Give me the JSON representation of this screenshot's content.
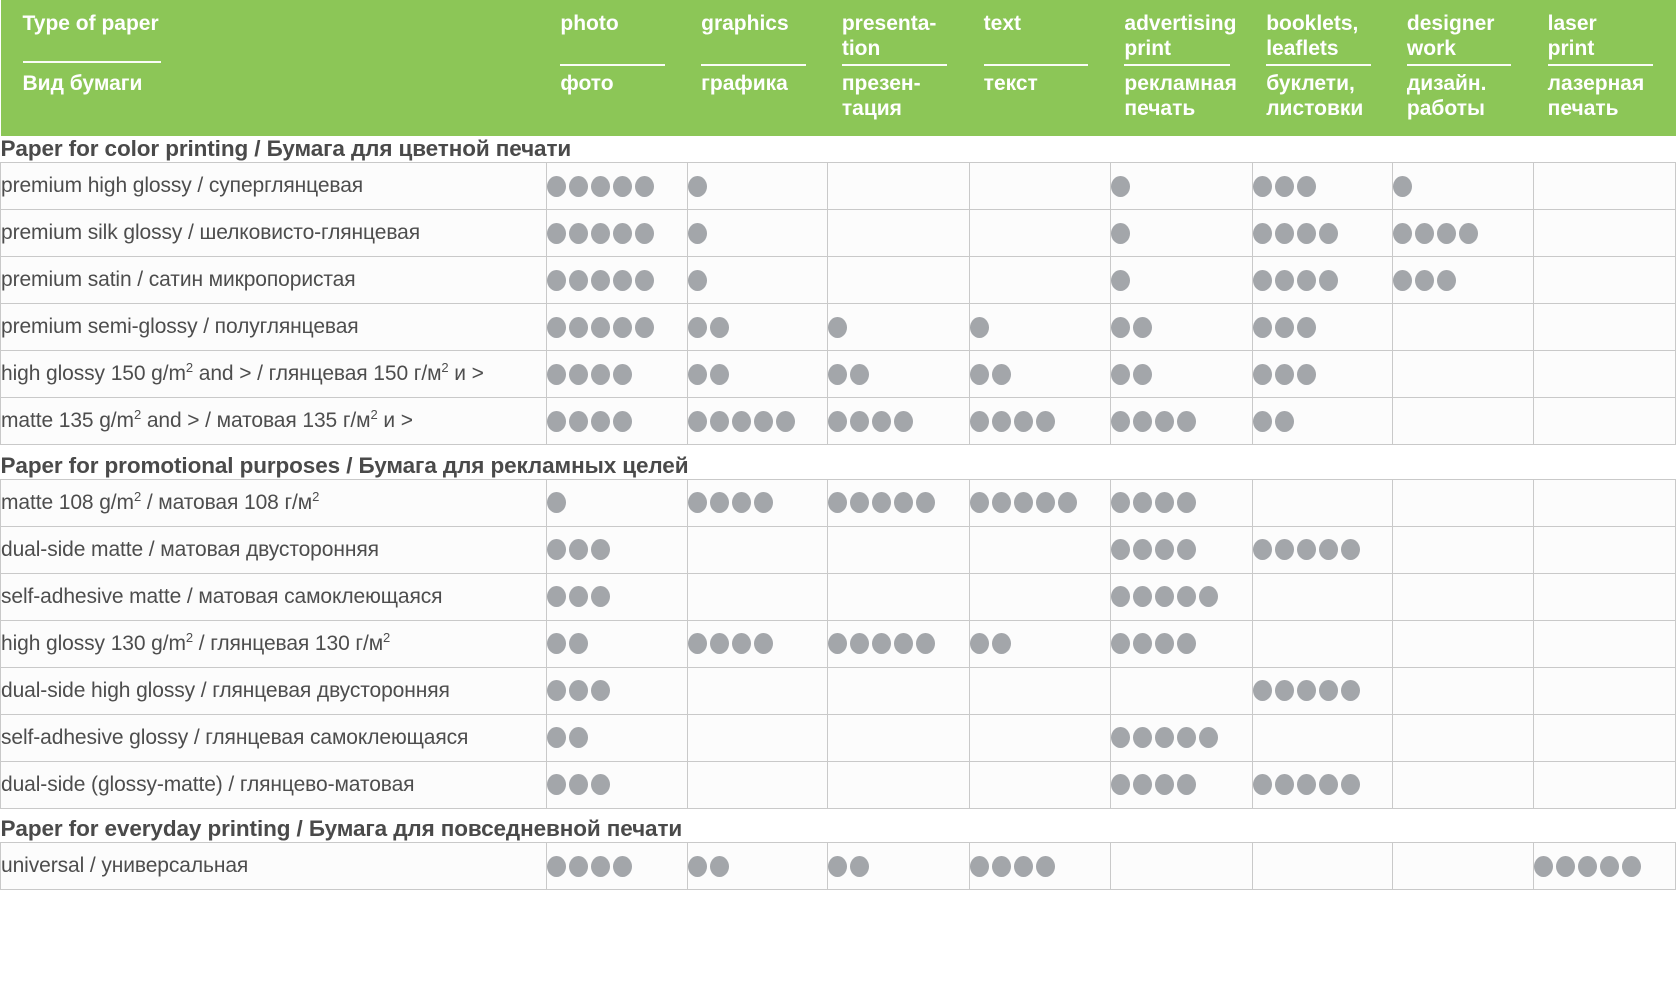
{
  "header": {
    "row_label_col": {
      "en": "Type of paper",
      "ru": "Вид бумаги"
    },
    "columns": [
      {
        "en": "photo",
        "ru": "фото"
      },
      {
        "en": "graphics",
        "ru": "графика"
      },
      {
        "en": "presenta-\ntion",
        "ru": "презен-\nтация"
      },
      {
        "en": "text",
        "ru": "текст"
      },
      {
        "en": "advertising\nprint",
        "ru": "рекламная\nпечать"
      },
      {
        "en": "booklets,\nleaflets",
        "ru": "буклети,\nлистовки"
      },
      {
        "en": "designer\nwork",
        "ru": "дизайн.\nработы"
      },
      {
        "en": "laser\nprint",
        "ru": "лазерная\nпечать"
      }
    ]
  },
  "colors": {
    "header_green": "#8cc657",
    "dot_gray": "#a3a6aa",
    "grid_line": "#c9c9c9",
    "text_dark": "#4d4d4d"
  },
  "sections": [
    {
      "title": "Paper for color printing / Бумага для цветной печати",
      "rows": [
        {
          "label": "premium high glossy / суперглянцевая",
          "dots": [
            5,
            1,
            0,
            0,
            1,
            3,
            1,
            0
          ]
        },
        {
          "label": "premium silk glossy / шелковисто-глянцевая",
          "dots": [
            5,
            1,
            0,
            0,
            1,
            4,
            4,
            0
          ]
        },
        {
          "label": "premium satin / сатин микропористая",
          "dots": [
            5,
            1,
            0,
            0,
            1,
            4,
            3,
            0
          ]
        },
        {
          "label": "premium semi-glossy / полуглянцевая",
          "dots": [
            5,
            2,
            1,
            1,
            2,
            3,
            0,
            0
          ]
        },
        {
          "label": "high glossy 150 g/m² and > / глянцевая 150 г/м² и >",
          "dots": [
            4,
            2,
            2,
            2,
            2,
            3,
            0,
            0
          ]
        },
        {
          "label": "matte 135 g/m² and > / матовая 135 г/м² и >",
          "dots": [
            4,
            5,
            4,
            4,
            4,
            2,
            0,
            0
          ]
        }
      ]
    },
    {
      "title": "Paper for promotional purposes / Бумага для рекламных целей",
      "rows": [
        {
          "label": "matte 108 g/m² / матовая 108 г/м²",
          "dots": [
            1,
            4,
            5,
            5,
            4,
            0,
            0,
            0
          ]
        },
        {
          "label": "dual-side matte / матовая двусторонняя",
          "dots": [
            3,
            0,
            0,
            0,
            4,
            5,
            0,
            0
          ]
        },
        {
          "label": "self-adhesive matte / матовая самоклеющаяся",
          "dots": [
            3,
            0,
            0,
            0,
            5,
            0,
            0,
            0
          ]
        },
        {
          "label": "high glossy 130 g/m² / глянцевая 130 г/м²",
          "dots": [
            2,
            4,
            5,
            2,
            4,
            0,
            0,
            0
          ]
        },
        {
          "label": "dual-side high glossy / глянцевая двусторонняя",
          "dots": [
            3,
            0,
            0,
            0,
            0,
            5,
            0,
            0
          ]
        },
        {
          "label": "self-adhesive glossy / глянцевая самоклеющаяся",
          "dots": [
            2,
            0,
            0,
            0,
            5,
            0,
            0,
            0
          ]
        },
        {
          "label": "dual-side (glossy-matte) / глянцево-матовая",
          "dots": [
            3,
            0,
            0,
            0,
            4,
            5,
            0,
            0
          ]
        }
      ]
    },
    {
      "title": "Paper for everyday printing / Бумага для повседневной печати",
      "rows": [
        {
          "label": "universal / универсальная",
          "dots": [
            4,
            2,
            2,
            4,
            0,
            0,
            0,
            5
          ]
        }
      ]
    }
  ]
}
